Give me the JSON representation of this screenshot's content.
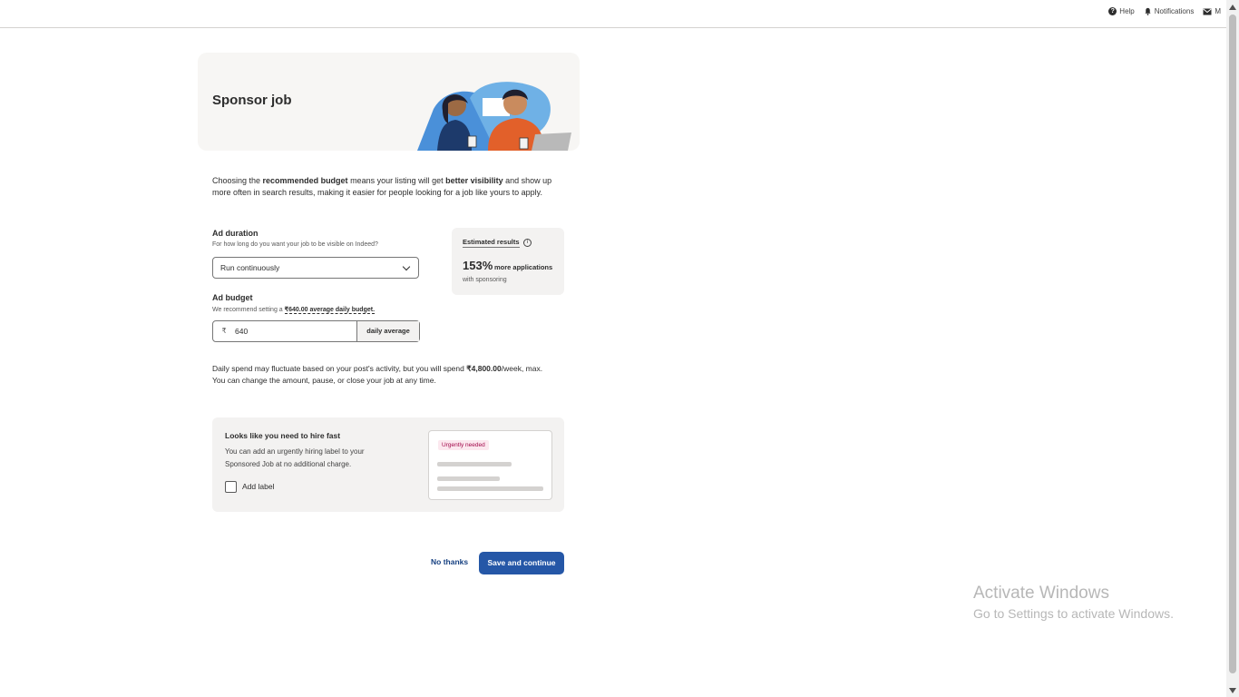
{
  "topbar": {
    "help_label": "Help",
    "notifications_label": "Notifications",
    "messages_label": "M"
  },
  "hero": {
    "title": "Sponsor job"
  },
  "intro": {
    "part1": "Choosing the ",
    "bold1": "recommended budget",
    "part2": " means your listing will get ",
    "bold2": "better visibility",
    "part3": " and show up more often in search results, making it easier for people looking for a job like yours to apply."
  },
  "duration": {
    "label": "Ad duration",
    "help": "For how long do you want your job to be visible on Indeed?",
    "selected": "Run continuously"
  },
  "estimate": {
    "title": "Estimated results",
    "info_glyph": "i",
    "percent": "153%",
    "more": "more applications",
    "with": "with sponsoring"
  },
  "budget": {
    "label": "Ad budget",
    "help_prefix": "We recommend setting a ",
    "help_link": "₹640.00 average daily budget.",
    "currency": "₹",
    "value": "640",
    "suffix": "daily average"
  },
  "spend": {
    "part1": "Daily spend may fluctuate based on your post's activity, but you will spend ",
    "amount": "₹4,800.00",
    "part2": "/week, max.",
    "line2": "You can change the amount, pause, or close your job at any time."
  },
  "hire_fast": {
    "title": "Looks like you need to hire fast",
    "description": "You can add an urgently hiring label to your Sponsored Job at no additional charge.",
    "checkbox_label": "Add label",
    "tag": "Urgently needed"
  },
  "actions": {
    "no_thanks": "No thanks",
    "save": "Save and continue"
  },
  "watermark": {
    "line1": "Activate Windows",
    "line2": "Go to Settings to activate Windows."
  },
  "colors": {
    "primary": "#2557a7",
    "link": "#164081",
    "tag_bg": "#fce8ef",
    "tag_text": "#a2084a"
  }
}
